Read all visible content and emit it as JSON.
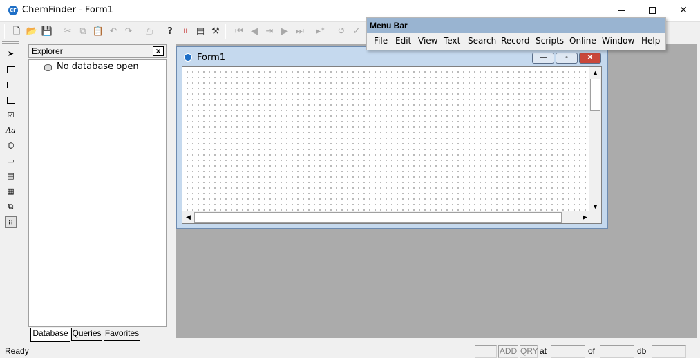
{
  "window": {
    "title": "ChemFinder - Form1",
    "icon": "chemfinder-app-icon"
  },
  "toolbar": {
    "buttons": [
      "new-icon",
      "open-icon",
      "save-icon",
      "cut-icon",
      "copy-icon",
      "paste-icon",
      "undo-icon",
      "redo-icon",
      "print-icon",
      "help-icon",
      "select-frame-icon",
      "form-view-icon",
      "wand-icon",
      "first-record-icon",
      "prev-record-icon",
      "goto-record-icon",
      "next-record-icon",
      "last-record-icon",
      "new-record-icon",
      "undo-record-icon",
      "commit-icon"
    ]
  },
  "palette": {
    "tools": [
      "pointer-icon",
      "frame-box-icon",
      "form-box-icon",
      "text-box-icon",
      "checkbox-icon",
      "label-text-icon",
      "structure-box-icon",
      "button-icon",
      "list-box-icon",
      "grid-icon",
      "subform-icon",
      "dot-grid-icon"
    ]
  },
  "explorer": {
    "title": "Explorer",
    "close_label": "×",
    "tree_item": "No database open",
    "tabs": [
      "Database",
      "Queries",
      "Favorites"
    ]
  },
  "form1": {
    "title": "Form1",
    "min_label": "—",
    "max_label": "▫",
    "close_label": "✕"
  },
  "menu_bar_window": {
    "title": "Menu Bar",
    "items": [
      "File",
      "Edit",
      "View",
      "Text",
      "Search",
      "Record",
      "Scripts",
      "Online",
      "Window",
      "Help"
    ]
  },
  "statusbar": {
    "status": "Ready",
    "add": "ADD",
    "qry": "QRY",
    "at_label": "at",
    "of_label": "of",
    "db_label": "db"
  }
}
